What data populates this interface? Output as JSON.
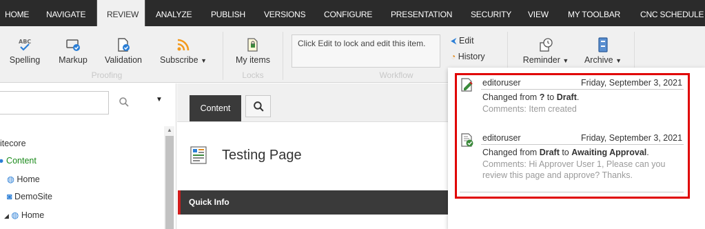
{
  "top_tabs": {
    "home": "HOME",
    "navigate": "NAVIGATE",
    "review": "REVIEW",
    "analyze": "ANALYZE",
    "publish": "PUBLISH",
    "versions": "VERSIONS",
    "configure": "CONFIGURE",
    "presentation": "PRESENTATION",
    "security": "SECURITY",
    "view": "VIEW",
    "my_toolbar": "MY TOOLBAR",
    "cnc_schedule": "CNC SCHEDULE",
    "active": "REVIEW"
  },
  "ribbon": {
    "spelling": "Spelling",
    "markup": "Markup",
    "validation": "Validation",
    "subscribe": "Subscribe",
    "proofing_group": "Proofing",
    "my_items": "My items",
    "locks_group": "Locks",
    "lock_message": "Click Edit to lock and edit this item.",
    "edit": "Edit",
    "history": "History",
    "workflow_group": "Workflow",
    "reminder": "Reminder",
    "archive": "Archive"
  },
  "tree": {
    "root": "itecore",
    "content": "Content",
    "home": "Home",
    "demosite": "DemoSite",
    "demosite_home": "Home"
  },
  "content": {
    "tab_label": "Content",
    "page_title": "Testing Page",
    "quick_info": "Quick Info"
  },
  "history": {
    "entries": [
      {
        "user": "editoruser",
        "date": "Friday, September 3, 2021",
        "prefix": "Changed from ",
        "from": "?",
        "middle": " to ",
        "to": "Draft",
        "suffix": ".",
        "comments_line1": "Comments: Item created",
        "comments_line2": ""
      },
      {
        "user": "editoruser",
        "date": "Friday, September 3, 2021",
        "prefix": "Changed from ",
        "from": "Draft",
        "middle": " to ",
        "to": "Awaiting Approval",
        "suffix": ".",
        "comments_line1": "Comments: Hi Approver User 1, Please can you",
        "comments_line2": "review this page and approve? Thanks."
      }
    ]
  },
  "colors": {
    "topbar": "#2b2b2b",
    "highlight": "#e00000",
    "accent_red": "#d11c1c",
    "tree_green": "#1a8a1a"
  },
  "icons": [
    "spelling-icon",
    "markup-icon",
    "validation-icon",
    "rss-icon",
    "my-items-icon",
    "edit-icon",
    "history-icon",
    "reminder-icon",
    "archive-icon",
    "search-icon",
    "dropdown-icon",
    "globe-icon",
    "page-template-icon",
    "edit-document-icon",
    "approved-document-icon"
  ]
}
